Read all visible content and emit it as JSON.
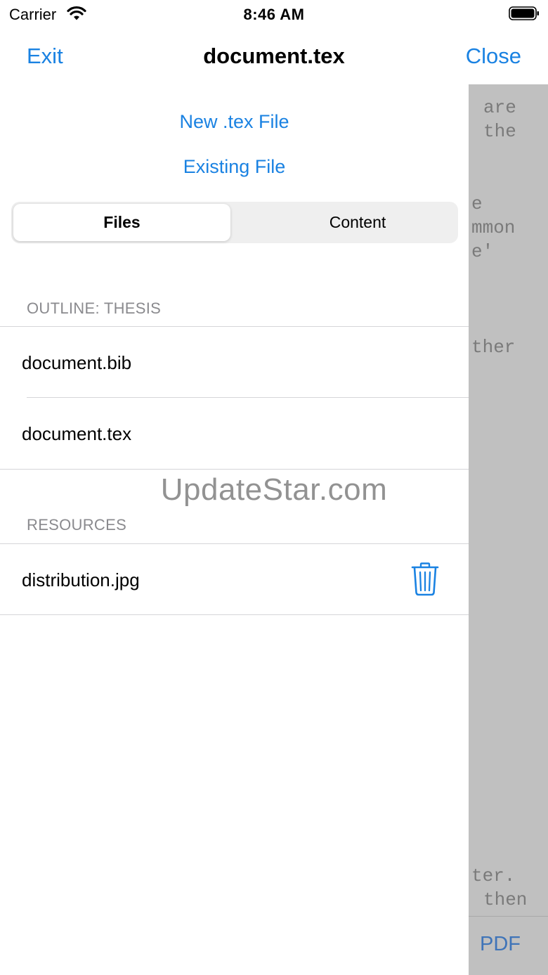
{
  "status_bar": {
    "carrier": "Carrier",
    "time": "8:46 AM"
  },
  "nav": {
    "left": "Exit",
    "title": "document.tex",
    "right": "Close"
  },
  "actions": {
    "new_file": "New .tex File",
    "existing_file": "Existing File"
  },
  "segments": {
    "files": "Files",
    "content": "Content",
    "selected": "Files"
  },
  "sections": [
    {
      "header": "OUTLINE: THESIS",
      "rows": [
        "document.bib",
        "document.tex"
      ]
    },
    {
      "header": "RESOURCES",
      "rows": [
        "distribution.jpg"
      ]
    }
  ],
  "editor": {
    "lines": [
      "are",
      "the",
      "e",
      "mmon",
      "e'",
      "ther",
      "ter.",
      "then"
    ],
    "pdf_button": "PDF"
  },
  "watermark": "UpdateStar.com",
  "colors": {
    "accent": "#1a82e2",
    "editor_bg": "#c0c0c0",
    "section_header": "#8a8a8e"
  },
  "icons": {
    "wifi": "wifi-icon",
    "battery": "battery-icon",
    "trash": "trash-icon"
  }
}
